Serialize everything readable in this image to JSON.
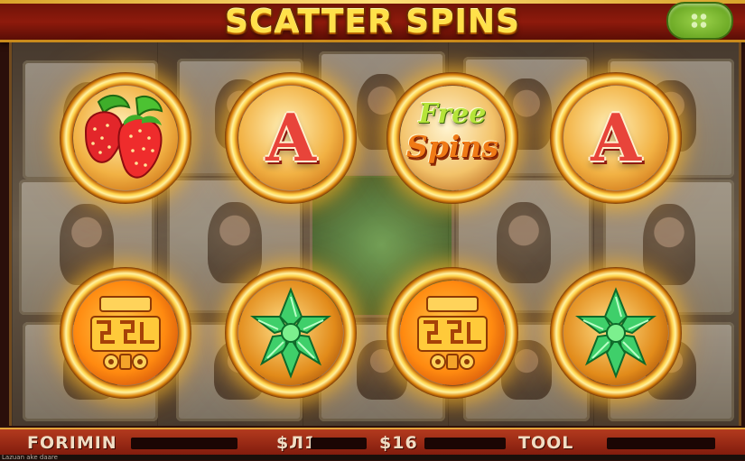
{
  "header": {
    "title": "SCATTER SPINS"
  },
  "reels": {
    "row1": [
      {
        "symbol": "strawberry",
        "icon": "strawberry-icon"
      },
      {
        "symbol": "letter-a",
        "label": "A"
      },
      {
        "symbol": "free-spins",
        "word1": "Free",
        "word2": "Spins"
      },
      {
        "symbol": "letter-a",
        "label": "A"
      }
    ],
    "row2": [
      {
        "symbol": "aztec-mask",
        "icon": "aztec-mask-icon"
      },
      {
        "symbol": "green-gem",
        "icon": "green-gem-icon"
      },
      {
        "symbol": "aztec-mask",
        "icon": "aztec-mask-icon"
      },
      {
        "symbol": "green-gem",
        "icon": "green-gem-icon"
      }
    ]
  },
  "footer": {
    "label1": "FORIMIN",
    "label2": "$Л1",
    "label3": "$16",
    "label4": "TOOL",
    "caption": "Lazuan ake daare"
  },
  "colors": {
    "title": "#ffe14a",
    "frame_gold": "#ffd24a",
    "bar_red": "#8e1a0c"
  }
}
